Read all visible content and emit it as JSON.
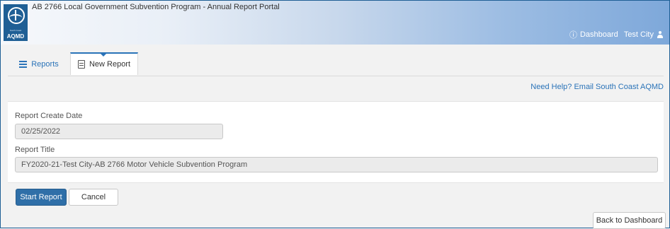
{
  "header": {
    "app_title": "AB 2766 Local Government Subvention Program - Annual Report Portal",
    "logo_small_text": "South Coast",
    "logo_text": "AQMD",
    "dashboard_label": "Dashboard",
    "user_name": "Test City"
  },
  "tabs": [
    {
      "label": "Reports",
      "icon": "list-icon"
    },
    {
      "label": "New Report",
      "icon": "document-icon",
      "active": true
    }
  ],
  "help_link": "Need Help? Email South Coast AQMD",
  "form": {
    "create_date_label": "Report Create Date",
    "create_date_value": "02/25/2022",
    "title_label": "Report Title",
    "title_value": "FY2020-21-Test City-AB 2766 Motor Vehicle Subvention Program"
  },
  "buttons": {
    "start": "Start Report",
    "cancel": "Cancel",
    "back": "Back to Dashboard"
  },
  "colors": {
    "brand": "#1f5f95",
    "accent": "#2a73b8",
    "primary_button": "#2f6fa8"
  }
}
